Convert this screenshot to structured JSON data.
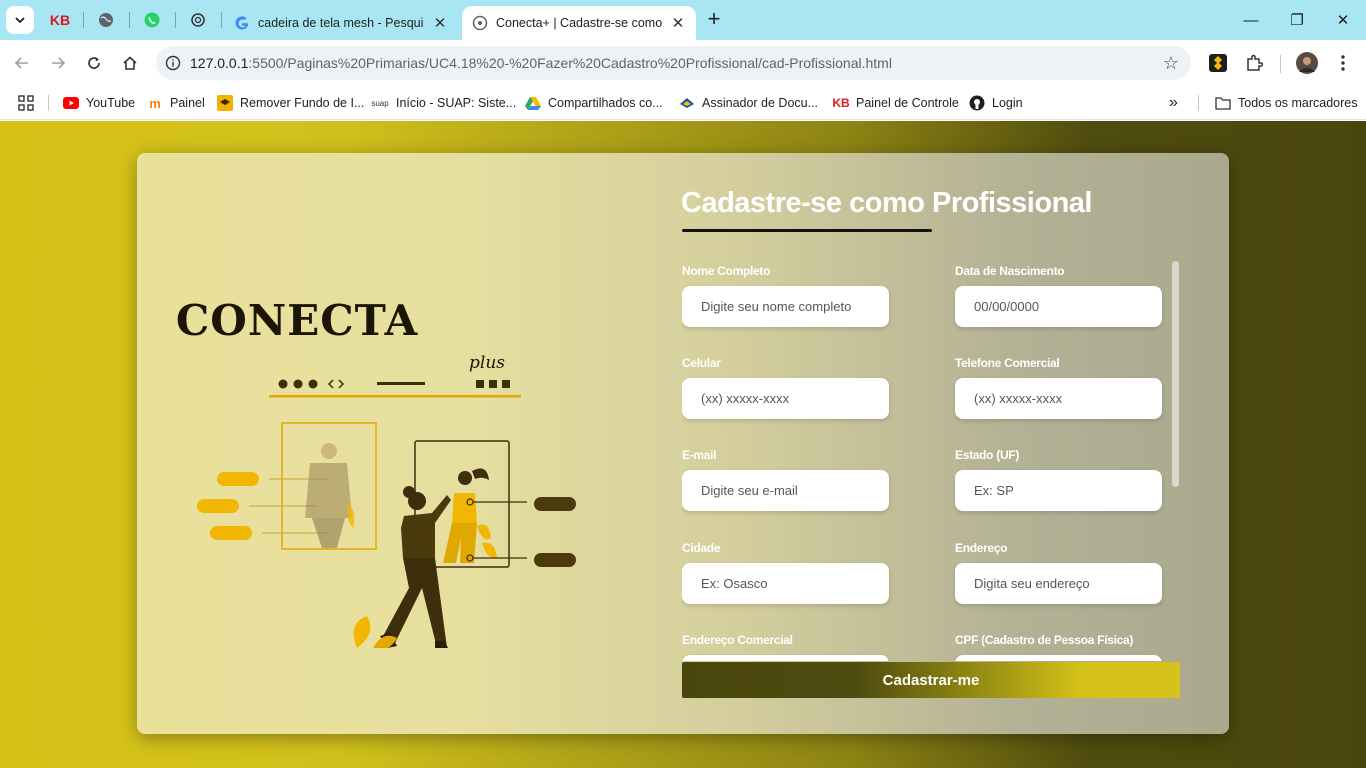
{
  "browser": {
    "pinned_tabs": [
      {
        "icon": "kb-icon",
        "label": "KB"
      },
      {
        "icon": "globe-icon",
        "label": ""
      },
      {
        "icon": "whatsapp-icon",
        "label": ""
      },
      {
        "icon": "openai-icon",
        "label": ""
      }
    ],
    "tabs": [
      {
        "title": "cadeira de tela mesh - Pesquisa",
        "close": "✕",
        "active": false
      },
      {
        "title": "Conecta+ | Cadastre-se como p",
        "close": "✕",
        "active": true
      }
    ],
    "new_tab": "+",
    "window_controls": {
      "minimize": "—",
      "restore": "❐",
      "close": "✕"
    },
    "url_host": "127.0.0.1",
    "url_rest": ":5500/Paginas%20Primarias/UC4.18%20-%20Fazer%20Cadastro%20Profissional/cad-Profissional.html",
    "bookmarks": [
      {
        "label": "YouTube",
        "icon": "youtube-icon"
      },
      {
        "label": "Painel",
        "icon": "moodle-icon"
      },
      {
        "label": "Remover Fundo de I...",
        "icon": "remove-bg-icon"
      },
      {
        "label": "Início - SUAP: Siste...",
        "icon": "suap-icon"
      },
      {
        "label": "Compartilhados co...",
        "icon": "google-drive-icon"
      },
      {
        "label": "Assinador de Docu...",
        "icon": "signer-icon"
      },
      {
        "label": "Painel de Controle",
        "icon": "kb-icon"
      },
      {
        "label": "Login",
        "icon": "github-icon"
      }
    ],
    "bookmarks_overflow": "»",
    "all_bookmarks": "Todos os marcadores",
    "kb_text": "KB",
    "suap_text": "suap"
  },
  "logo": {
    "main": "CONECTA",
    "sub": "plus"
  },
  "form": {
    "title": "Cadastre-se como Profissional",
    "fields": [
      {
        "label": "Nome Completo",
        "placeholder": "Digite seu nome completo"
      },
      {
        "label": "Data de Nascimento",
        "placeholder": "00/00/0000"
      },
      {
        "label": "Celular",
        "placeholder": "(xx) xxxxx-xxxx"
      },
      {
        "label": "Telefone Comercial",
        "placeholder": "(xx) xxxxx-xxxx"
      },
      {
        "label": "E-mail",
        "placeholder": "Digite seu e-mail"
      },
      {
        "label": "Estado (UF)",
        "placeholder": "Ex: SP"
      },
      {
        "label": "Cidade",
        "placeholder": "Ex: Osasco"
      },
      {
        "label": "Endereço",
        "placeholder": "Digita seu endereço"
      },
      {
        "label": "Endereço Comercial",
        "placeholder": ""
      },
      {
        "label": "CPF (Cadastro de Pessoa Física)",
        "placeholder": ""
      }
    ],
    "submit_label": "Cadastrar-me"
  },
  "colors": {
    "accent_yellow": "#d6c31a",
    "dark_olive": "#4a470e",
    "illustration_yellow": "#f2b705",
    "illustration_dark": "#3d2f0c"
  }
}
